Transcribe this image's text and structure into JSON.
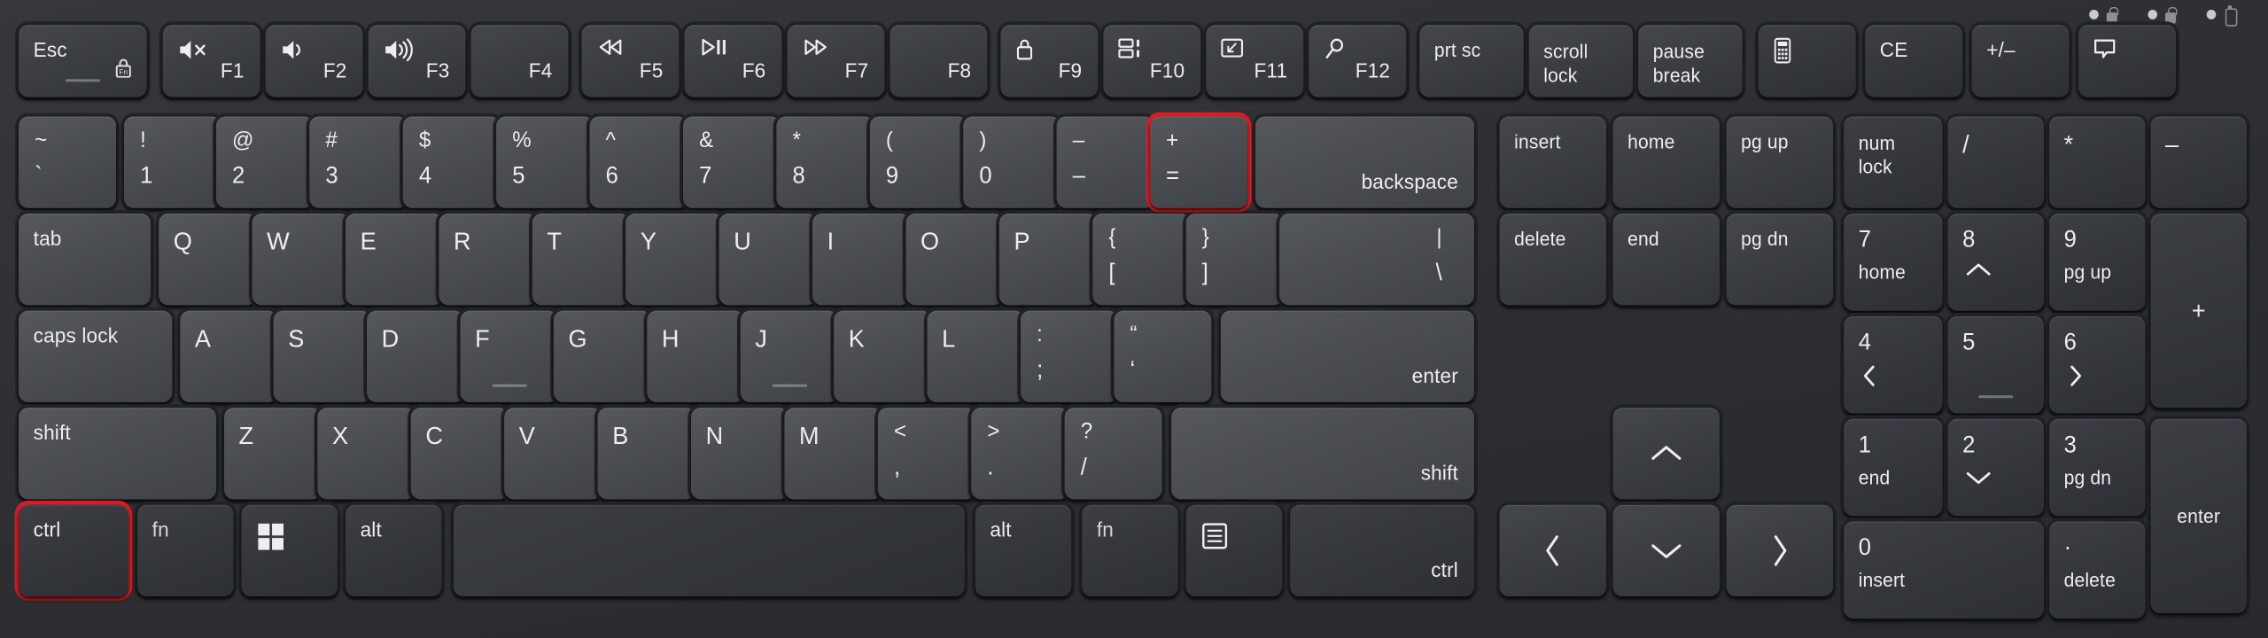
{
  "device": {
    "type": "keyboard",
    "layout": "full-size ANSI with numeric keypad",
    "body_color": "#2e3034",
    "key_color": "#4a4d51",
    "key_dark_color": "#3b3e42",
    "legend_color": "#eceeef",
    "highlight_color": "#e01b24"
  },
  "indicators": [
    {
      "name": "caps-lock-led",
      "icon": "lock-icon",
      "lit": false
    },
    {
      "name": "num-lock-led",
      "icon": "lock-icon",
      "lit": false
    },
    {
      "name": "battery-led",
      "icon": "battery-icon",
      "lit": false
    }
  ],
  "highlighted_keys": [
    "equal-plus",
    "ctrl-left"
  ],
  "rows": {
    "function_row": [
      {
        "id": "esc",
        "label": "Esc",
        "sub": "",
        "icon": "fn-lock-icon"
      },
      {
        "id": "f1",
        "label": "F1",
        "icon": "volume-mute-icon"
      },
      {
        "id": "f2",
        "label": "F2",
        "icon": "volume-down-icon"
      },
      {
        "id": "f3",
        "label": "F3",
        "icon": "volume-up-icon"
      },
      {
        "id": "f4",
        "label": "F4",
        "icon": ""
      },
      {
        "id": "f5",
        "label": "F5",
        "icon": "rewind-icon"
      },
      {
        "id": "f6",
        "label": "F6",
        "icon": "play-pause-icon"
      },
      {
        "id": "f7",
        "label": "F7",
        "icon": "fast-forward-icon"
      },
      {
        "id": "f8",
        "label": "F8",
        "icon": ""
      },
      {
        "id": "f9",
        "label": "F9",
        "icon": "lock-icon"
      },
      {
        "id": "f10",
        "label": "F10",
        "icon": "panel-layout-icon"
      },
      {
        "id": "f11",
        "label": "F11",
        "icon": "project-screen-icon"
      },
      {
        "id": "f12",
        "label": "F12",
        "icon": "search-icon"
      },
      {
        "id": "prtsc",
        "label": "prt sc",
        "icon": ""
      },
      {
        "id": "scrlk",
        "label": "scroll\nlock",
        "icon": ""
      },
      {
        "id": "pause",
        "label": "pause\nbreak",
        "icon": ""
      },
      {
        "id": "calc",
        "label": "",
        "icon": "calculator-icon"
      },
      {
        "id": "ce",
        "label": "CE",
        "icon": ""
      },
      {
        "id": "plusminus",
        "label": "+/–",
        "icon": ""
      },
      {
        "id": "chat",
        "label": "",
        "icon": "chat-bubble-icon"
      }
    ],
    "number_row": [
      {
        "id": "backtick",
        "top": "~",
        "bottom": "`"
      },
      {
        "id": "1",
        "top": "!",
        "bottom": "1"
      },
      {
        "id": "2",
        "top": "@",
        "bottom": "2"
      },
      {
        "id": "3",
        "top": "#",
        "bottom": "3"
      },
      {
        "id": "4",
        "top": "$",
        "bottom": "4"
      },
      {
        "id": "5",
        "top": "%",
        "bottom": "5"
      },
      {
        "id": "6",
        "top": "^",
        "bottom": "6"
      },
      {
        "id": "7",
        "top": "&",
        "bottom": "7"
      },
      {
        "id": "8",
        "top": "*",
        "bottom": "8"
      },
      {
        "id": "9",
        "top": "(",
        "bottom": "9"
      },
      {
        "id": "0",
        "top": ")",
        "bottom": "0"
      },
      {
        "id": "minus",
        "top": "–",
        "bottom": "–"
      },
      {
        "id": "equal-plus",
        "top": "+",
        "bottom": "="
      },
      {
        "id": "backspace",
        "label": "backspace"
      },
      {
        "id": "insert",
        "label": "insert"
      },
      {
        "id": "home",
        "label": "home"
      },
      {
        "id": "pgup",
        "label": "pg up"
      },
      {
        "id": "numlock",
        "label": "num\nlock"
      },
      {
        "id": "np-divide",
        "label": "/"
      },
      {
        "id": "np-multiply",
        "label": "*"
      },
      {
        "id": "np-minus",
        "label": "–"
      }
    ],
    "top_letter_row": [
      {
        "id": "tab",
        "label": "tab"
      },
      {
        "id": "q",
        "label": "Q"
      },
      {
        "id": "w",
        "label": "W"
      },
      {
        "id": "e",
        "label": "E"
      },
      {
        "id": "r",
        "label": "R"
      },
      {
        "id": "t",
        "label": "T"
      },
      {
        "id": "y",
        "label": "Y"
      },
      {
        "id": "u",
        "label": "U"
      },
      {
        "id": "i",
        "label": "I"
      },
      {
        "id": "o",
        "label": "O"
      },
      {
        "id": "p",
        "label": "P"
      },
      {
        "id": "lbracket",
        "top": "{",
        "bottom": "["
      },
      {
        "id": "rbracket",
        "top": "}",
        "bottom": "]"
      },
      {
        "id": "backslash",
        "top": "|",
        "bottom": "\\"
      },
      {
        "id": "delete",
        "label": "delete"
      },
      {
        "id": "end",
        "label": "end"
      },
      {
        "id": "pgdn",
        "label": "pg dn"
      },
      {
        "id": "np7",
        "top": "7",
        "bottom": "home"
      },
      {
        "id": "np8",
        "top": "8",
        "bottom": "up-chevron-icon"
      },
      {
        "id": "np9",
        "top": "9",
        "bottom": "pg up"
      },
      {
        "id": "np-plus",
        "label": "+"
      }
    ],
    "home_row": [
      {
        "id": "capslock",
        "label": "caps lock"
      },
      {
        "id": "a",
        "label": "A"
      },
      {
        "id": "s",
        "label": "S"
      },
      {
        "id": "d",
        "label": "D"
      },
      {
        "id": "f",
        "label": "F",
        "homing": true
      },
      {
        "id": "g",
        "label": "G"
      },
      {
        "id": "h",
        "label": "H"
      },
      {
        "id": "j",
        "label": "J",
        "homing": true
      },
      {
        "id": "k",
        "label": "K"
      },
      {
        "id": "l",
        "label": "L"
      },
      {
        "id": "semicolon",
        "top": ":",
        "bottom": ";"
      },
      {
        "id": "quote",
        "top": "“",
        "bottom": "‘"
      },
      {
        "id": "enter",
        "label": "enter"
      },
      {
        "id": "np4",
        "top": "4",
        "bottom": "left-chevron-icon"
      },
      {
        "id": "np5",
        "top": "5",
        "bottom": "",
        "homing": true
      },
      {
        "id": "np6",
        "top": "6",
        "bottom": "right-chevron-icon"
      }
    ],
    "shift_row": [
      {
        "id": "shift-left",
        "label": "shift"
      },
      {
        "id": "z",
        "label": "Z"
      },
      {
        "id": "x",
        "label": "X"
      },
      {
        "id": "c",
        "label": "C"
      },
      {
        "id": "v",
        "label": "V"
      },
      {
        "id": "b",
        "label": "B"
      },
      {
        "id": "n",
        "label": "N"
      },
      {
        "id": "m",
        "label": "M"
      },
      {
        "id": "comma",
        "top": "<",
        "bottom": ","
      },
      {
        "id": "period",
        "top": ">",
        "bottom": "."
      },
      {
        "id": "slash",
        "top": "?",
        "bottom": "/"
      },
      {
        "id": "shift-right",
        "label": "shift"
      },
      {
        "id": "arrow-up",
        "label": "up-chevron-icon"
      },
      {
        "id": "np1",
        "top": "1",
        "bottom": "end"
      },
      {
        "id": "np2",
        "top": "2",
        "bottom": "down-chevron-icon"
      },
      {
        "id": "np3",
        "top": "3",
        "bottom": "pg dn"
      },
      {
        "id": "np-enter",
        "label": "enter"
      }
    ],
    "bottom_row": [
      {
        "id": "ctrl-left",
        "label": "ctrl"
      },
      {
        "id": "fn-left",
        "label": "fn"
      },
      {
        "id": "win",
        "label": "windows-icon"
      },
      {
        "id": "alt-left",
        "label": "alt"
      },
      {
        "id": "space",
        "label": ""
      },
      {
        "id": "alt-right",
        "label": "alt"
      },
      {
        "id": "fn-right",
        "label": "fn"
      },
      {
        "id": "menu",
        "label": "menu-icon"
      },
      {
        "id": "ctrl-right",
        "label": "ctrl"
      },
      {
        "id": "arrow-left",
        "label": "left-chevron-icon"
      },
      {
        "id": "arrow-down",
        "label": "down-chevron-icon"
      },
      {
        "id": "arrow-right",
        "label": "right-chevron-icon"
      },
      {
        "id": "np0",
        "top": "0",
        "bottom": "insert"
      },
      {
        "id": "np-period",
        "top": "·",
        "bottom": "delete"
      }
    ]
  },
  "labels": {
    "esc": "Esc",
    "f1": "F1",
    "f2": "F2",
    "f3": "F3",
    "f4": "F4",
    "f5": "F5",
    "f6": "F6",
    "f7": "F7",
    "f8": "F8",
    "f9": "F9",
    "f10": "F10",
    "f11": "F11",
    "f12": "F12",
    "prtsc": "prt sc",
    "scrlk": "scroll\nlock",
    "pause": "pause\nbreak",
    "ce": "CE",
    "plusminus": "+/–",
    "tilde_top": "~",
    "tilde_bot": "`",
    "k1_top": "!",
    "k1_bot": "1",
    "k2_top": "@",
    "k2_bot": "2",
    "k3_top": "#",
    "k3_bot": "3",
    "k4_top": "$",
    "k4_bot": "4",
    "k5_top": "%",
    "k5_bot": "5",
    "k6_top": "^",
    "k6_bot": "6",
    "k7_top": "&",
    "k7_bot": "7",
    "k8_top": "*",
    "k8_bot": "8",
    "k9_top": "(",
    "k9_bot": "9",
    "k0_top": ")",
    "k0_bot": "0",
    "minus_top": "–",
    "minus_bot": "–",
    "equal_top": "+",
    "equal_bot": "=",
    "backspace": "backspace",
    "insert": "insert",
    "home": "home",
    "pgup": "pg up",
    "numlock": "num\nlock",
    "npdiv": "/",
    "npmul": "*",
    "npsub": "–",
    "tab": "tab",
    "q": "Q",
    "w": "W",
    "e": "E",
    "r": "R",
    "t": "T",
    "y": "Y",
    "u": "U",
    "i": "I",
    "o": "O",
    "p": "P",
    "lb_top": "{",
    "lb_bot": "[",
    "rb_top": "}",
    "rb_bot": "]",
    "bs_top": "|",
    "bs_bot": "\\",
    "delete": "delete",
    "end": "end",
    "pgdn": "pg dn",
    "np7_top": "7",
    "np7_bot": "home",
    "np8_top": "8",
    "np9_top": "9",
    "np9_bot": "pg up",
    "npadd": "+",
    "capslock": "caps lock",
    "a": "A",
    "s": "S",
    "d": "D",
    "f": "F",
    "g": "G",
    "h": "H",
    "j": "J",
    "k": "K",
    "l": "L",
    "semi_top": ":",
    "semi_bot": ";",
    "quote_top": "“",
    "quote_bot": "‘",
    "enter": "enter",
    "np4_top": "4",
    "np5_top": "5",
    "np6_top": "6",
    "shift": "shift",
    "z": "Z",
    "x": "X",
    "c": "C",
    "v": "V",
    "b": "B",
    "n": "N",
    "m": "M",
    "comma_top": "<",
    "comma_bot": ",",
    "period_top": ">",
    "period_bot": ".",
    "slash_top": "?",
    "slash_bot": "/",
    "np1_top": "1",
    "np1_bot": "end",
    "np2_top": "2",
    "np3_top": "3",
    "np3_bot": "pg dn",
    "npenter": "enter",
    "ctrl": "ctrl",
    "fn": "fn",
    "alt": "alt",
    "np0_top": "0",
    "np0_bot": "insert",
    "npdot_top": "·",
    "npdot_bot": "delete"
  }
}
